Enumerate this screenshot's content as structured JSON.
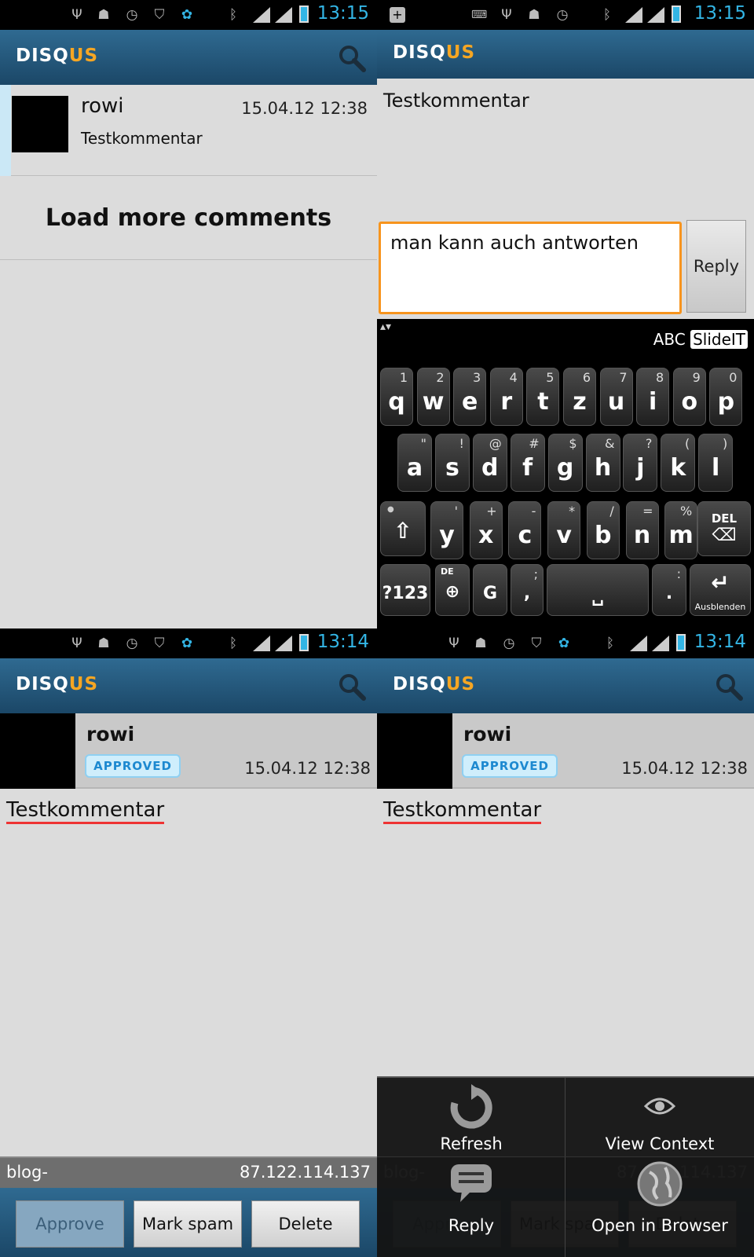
{
  "status": {
    "time_top": "13:15",
    "time_bottom": "13:14"
  },
  "app": {
    "logo_a": "DISQ",
    "logo_b": "US"
  },
  "list": {
    "author": "rowi",
    "date": "15.04.12 12:38",
    "snippet": "Testkommentar",
    "load_more": "Load more comments"
  },
  "reply": {
    "comment": "Testkommentar",
    "input_value": "man kann auch antworten",
    "button": "Reply"
  },
  "keyboard": {
    "mode_abc": "ABC",
    "mode_slideit": "SlideIT",
    "row1": [
      [
        "q",
        "1"
      ],
      [
        "w",
        "2"
      ],
      [
        "e",
        "3"
      ],
      [
        "r",
        "4"
      ],
      [
        "t",
        "5"
      ],
      [
        "z",
        "6"
      ],
      [
        "u",
        "7"
      ],
      [
        "i",
        "8"
      ],
      [
        "o",
        "9"
      ],
      [
        "p",
        "0"
      ]
    ],
    "row2": [
      [
        "a",
        "\""
      ],
      [
        "s",
        "!"
      ],
      [
        "d",
        "@"
      ],
      [
        "f",
        "#"
      ],
      [
        "g",
        "$"
      ],
      [
        "h",
        "&"
      ],
      [
        "j",
        "?"
      ],
      [
        "k",
        "("
      ],
      [
        "l",
        ")"
      ]
    ],
    "row3": [
      [
        "y",
        "'"
      ],
      [
        "x",
        "+"
      ],
      [
        "c",
        "-"
      ],
      [
        "v",
        "*"
      ],
      [
        "b",
        "/"
      ],
      [
        "n",
        "="
      ],
      [
        "m",
        "%"
      ]
    ],
    "del": "DEL",
    "sym": "?123",
    "lang": "DE",
    "g": "G",
    "comma": ",",
    "comma_alt": ";",
    "period": ".",
    "period_alt": ":",
    "enter": "Ausblenden"
  },
  "detail": {
    "author": "rowi",
    "badge": "APPROVED",
    "date": "15.04.12 12:38",
    "body": "Testkommentar",
    "source": "blog-",
    "ip": "87.122.114.137",
    "approve": "Approve",
    "spam": "Mark spam",
    "delete": "Delete"
  },
  "menu": {
    "refresh": "Refresh",
    "view_context": "View Context",
    "reply": "Reply",
    "open_browser": "Open in Browser"
  },
  "colors": {
    "accent": "#33b5e5",
    "brand_orange": "#f6a623",
    "bar": "#2f6a91"
  }
}
